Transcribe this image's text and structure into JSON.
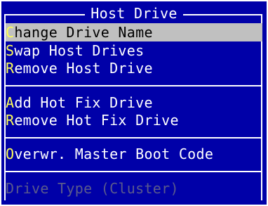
{
  "menu": {
    "title": "Host Drive",
    "items": [
      {
        "hotkey": "C",
        "rest": "hange Drive Name",
        "state": "selected"
      },
      {
        "hotkey": "S",
        "rest": "wap Host Drives",
        "state": "normal"
      },
      {
        "hotkey": "R",
        "rest": "emove Host Drive",
        "state": "normal"
      },
      {
        "hotkey": "A",
        "rest": "dd Hot Fix Drive",
        "state": "normal"
      },
      {
        "hotkey": "R",
        "rest": "emove Hot Fix Drive",
        "state": "normal"
      },
      {
        "hotkey": "O",
        "rest": "verwr. Master Boot Code",
        "state": "normal"
      },
      {
        "hotkey": "",
        "rest": "Drive Type (Cluster)",
        "state": "disabled"
      }
    ]
  },
  "colors": {
    "background": "#0000a8",
    "text": "#ffffff",
    "hotkey": "#ffff55",
    "highlight_bg": "#c0c0c0",
    "disabled_text": "#5a5a8c"
  }
}
